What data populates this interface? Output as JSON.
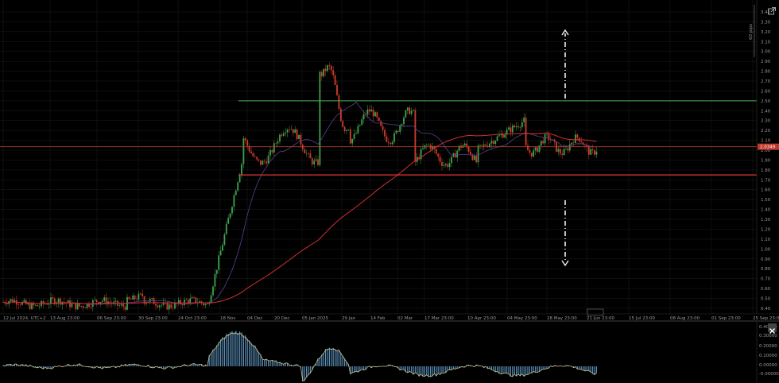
{
  "price_axis": {
    "labels": [
      "3.40",
      "3.30",
      "3.20",
      "3.10",
      "3.00",
      "2.90",
      "2.80",
      "2.70",
      "2.60",
      "2.50",
      "2.40",
      "2.30",
      "2.20",
      "2.10",
      "2.00",
      "1.90",
      "1.80",
      "1.70",
      "1.60",
      "1.50",
      "1.40",
      "1.30",
      "1.20",
      "1.10",
      "1.00",
      "0.90",
      "0.80",
      "0.70",
      "0.60",
      "0.50",
      "0.40"
    ],
    "current_price": "2.0349",
    "pips_label": "60 pips"
  },
  "time_axis": {
    "labels": [
      "12 Jul 2024, UTC+2",
      "13 Aug 23:00",
      "06 Sep 23:00",
      "30 Sep 23:00",
      "24 Oct 23:00",
      "18 Nov",
      "04 Dec",
      "20 Dec",
      "05 Jan 2025",
      "29 Jan",
      "14 Feb",
      "02 Mar",
      "17 Mar 23:00",
      "10 Apr 23:00",
      "04 May 23:00",
      "28 May 23:00",
      "21 Jun 23:00",
      "15 Jul 23:00",
      "08 Aug 23:00",
      "01 Sep 23:00",
      "25 Sep 23:00"
    ]
  },
  "oscillator_axis": {
    "labels": [
      "0.40000",
      "0.30000",
      "0.20000",
      "0.10000",
      "0.00000",
      "-0.00000"
    ]
  },
  "levels": {
    "resistance": 2.5,
    "support": 1.75,
    "current": 2.0349
  },
  "colors": {
    "background": "#000000",
    "grid": "#1c1c1c",
    "bull_candle": "#3fa34d",
    "bear_candle": "#d23c2a",
    "resistance_line": "#4caf50",
    "support_line": "#e53935",
    "current_line": "#b0442a",
    "ma_slow": "#d32f2f",
    "ma_fast": "#5c3f8f",
    "osc_bars": "#5a8fb8",
    "osc_line": "#c9c48a",
    "axis_text": "#9a9a9a",
    "price_tag": "#c0392b"
  },
  "icons": {
    "popout": "popout-icon",
    "close_pane": "close-icon",
    "up_arrow": "dash-dot-up-arrow",
    "down_arrow": "dash-dot-down-arrow"
  }
}
